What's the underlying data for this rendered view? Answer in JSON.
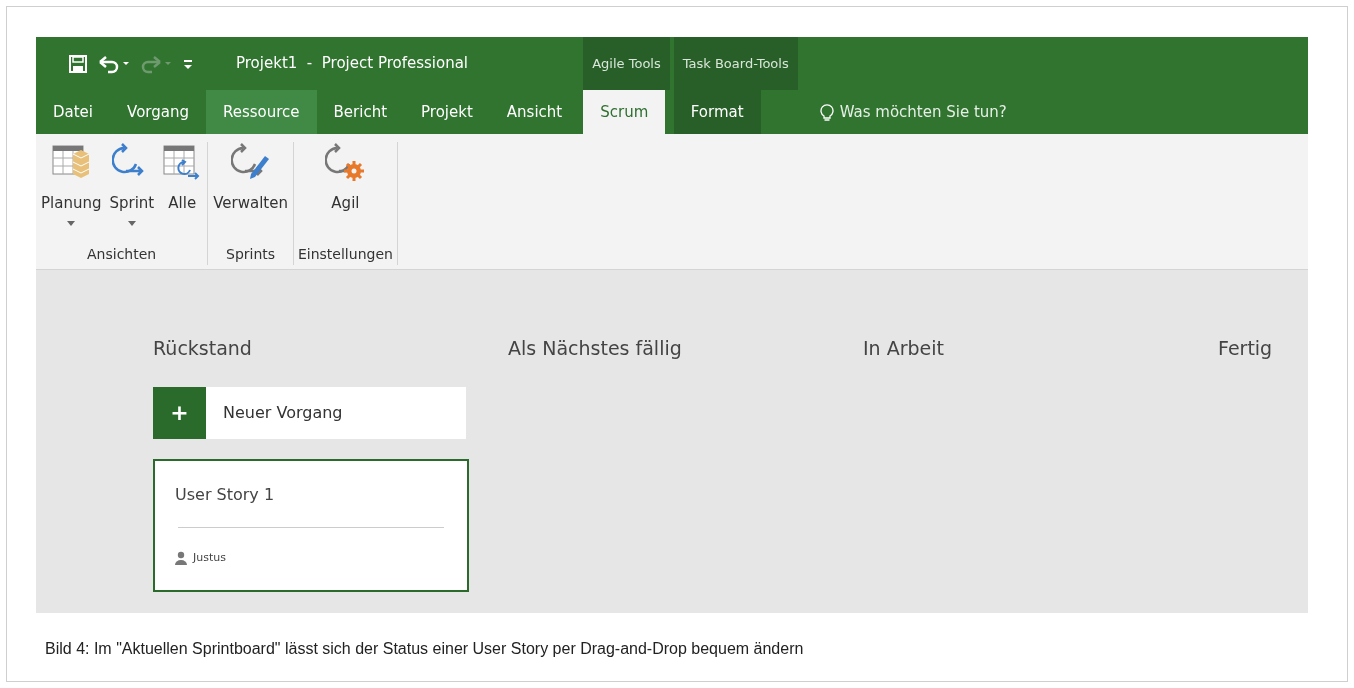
{
  "window": {
    "title": "Projekt1  -  Project Professional"
  },
  "quick_access": [
    {
      "kind": "save",
      "disabled": false
    },
    {
      "kind": "undo",
      "disabled": false
    },
    {
      "kind": "redo",
      "disabled": true
    },
    {
      "kind": "customize",
      "disabled": false
    }
  ],
  "context_groups": [
    {
      "label": "Agile Tools",
      "tabs": [
        {
          "label": "Scrum",
          "selected": true
        }
      ]
    },
    {
      "label": "Task Board-Tools",
      "tabs": [
        {
          "label": "Format",
          "selected": false
        }
      ]
    }
  ],
  "tabs": [
    {
      "label": "Datei",
      "selected": false,
      "highlighted": false
    },
    {
      "label": "Vorgang",
      "selected": false,
      "highlighted": false
    },
    {
      "label": "Ressource",
      "selected": false,
      "highlighted": true
    },
    {
      "label": "Bericht",
      "selected": false,
      "highlighted": false
    },
    {
      "label": "Projekt",
      "selected": false,
      "highlighted": false
    },
    {
      "label": "Ansicht",
      "selected": false,
      "highlighted": false
    }
  ],
  "tell_me": {
    "placeholder": "Was möchten Sie tun?"
  },
  "ribbon_groups": [
    {
      "label": "Ansichten",
      "buttons": [
        {
          "label": "Planung",
          "kind": "planning",
          "dropdown": true
        },
        {
          "label": "Sprint",
          "kind": "sprint",
          "dropdown": true
        },
        {
          "label": "Alle",
          "kind": "all",
          "dropdown": false
        }
      ]
    },
    {
      "label": "Sprints",
      "buttons": [
        {
          "label": "Verwalten",
          "kind": "manage",
          "dropdown": false
        }
      ]
    },
    {
      "label": "Einstellungen",
      "buttons": [
        {
          "label": "Agil",
          "kind": "settings",
          "dropdown": false
        }
      ]
    }
  ],
  "board": {
    "columns": [
      {
        "title": "Rückstand",
        "new_task": {
          "icon": "+",
          "label": "Neuer Vorgang"
        },
        "cards": [
          {
            "title": "User Story 1",
            "assignee": "Justus",
            "selected": true
          }
        ]
      },
      {
        "title": "Als Nächstes fällig"
      },
      {
        "title": "In Arbeit"
      },
      {
        "title": "Fertig"
      }
    ]
  },
  "caption": "Bild 4: Im \"Aktuellen Sprintboard\" lässt sich der Status einer User Story per Drag-and-Drop bequem ändern"
}
